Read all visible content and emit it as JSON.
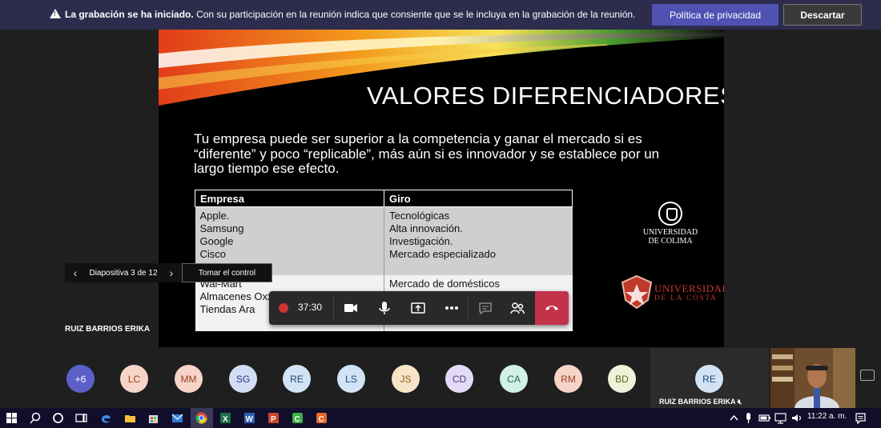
{
  "banner": {
    "bold": "La grabación se ha iniciado.",
    "message": "Con su participación en la reunión indica que consiente que se le incluya en la grabación de la reunión.",
    "privacy_button": "Política de privacidad",
    "dismiss_button": "Descartar"
  },
  "slide": {
    "title": "VALORES DIFERENCIADORES",
    "text": "Tu empresa puede ser superior a la competencia y ganar el mercado si es “diferente” y poco “replicable”, más aún si es innovador y se establece por un largo tiempo ese efecto.",
    "table": {
      "headers": [
        "Empresa",
        "Giro"
      ],
      "row1": {
        "c1": [
          "Apple.",
          "Samsung",
          "Google",
          "Cisco"
        ],
        "c2": [
          "Tecnológicas",
          "Alta innovación.",
          "Investigación.",
          "Mercado especializado"
        ]
      },
      "row2": {
        "c1": [
          "Wal-Mart",
          "Almacenes Oxxo",
          "Tiendas Ara"
        ],
        "c2": [
          "Mercado de domésticos",
          "",
          ""
        ]
      }
    },
    "logo_colima_line1": "UNIVERSIDAD",
    "logo_colima_line2": "DE COLIMA",
    "logo_costa_line1": "UNIVERSIDAD",
    "logo_costa_line2": "DE LA COSTA"
  },
  "slide_nav": {
    "label": "Diapositiva 3 de 12",
    "take_control": "Tomar el control"
  },
  "presenter_name": "RUIZ BARRIOS ERIKA",
  "callbar": {
    "timer": "37:30"
  },
  "participants": {
    "more": "+6",
    "list": [
      {
        "initials": "LC",
        "bg": "#f6d5c8",
        "fg": "#9a3b1e"
      },
      {
        "initials": "MM",
        "bg": "#f6d5c8",
        "fg": "#9a3b1e"
      },
      {
        "initials": "SG",
        "bg": "#d2dcf5",
        "fg": "#2a3f7a"
      },
      {
        "initials": "RE",
        "bg": "#d2e3f5",
        "fg": "#1f4a7a"
      },
      {
        "initials": "LS",
        "bg": "#d2e3f5",
        "fg": "#1f4a7a"
      },
      {
        "initials": "JS",
        "bg": "#f8e4c8",
        "fg": "#8a5a12"
      },
      {
        "initials": "CD",
        "bg": "#e3dbf5",
        "fg": "#4a3a7a"
      },
      {
        "initials": "CA",
        "bg": "#d2f0e4",
        "fg": "#1f6a4a"
      },
      {
        "initials": "RM",
        "bg": "#f6d5c8",
        "fg": "#9a3b1e"
      },
      {
        "initials": "BD",
        "bg": "#eef2d8",
        "fg": "#5a6a1e"
      }
    ],
    "self_initials": "RE",
    "self_name": "RUIZ BARRIOS ERIKA"
  },
  "taskbar": {
    "clock": "11:22 a. m."
  }
}
